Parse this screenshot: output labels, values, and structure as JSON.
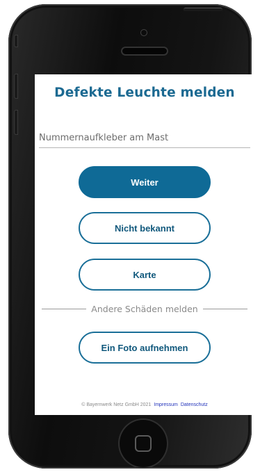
{
  "screen": {
    "title": "Defekte Leuchte melden",
    "number_input": {
      "placeholder": "Nummernaufkleber am Mast",
      "value": ""
    },
    "buttons": {
      "weiter": "Weiter",
      "nicht_bekannt": "Nicht bekannt",
      "karte": "Karte",
      "foto": "Ein Foto aufnehmen"
    },
    "divider_label": "Andere Schäden melden",
    "footer": {
      "copyright": "© Bayernwerk Netz GmbH 2021",
      "impressum": "Impressum",
      "datenschutz": "Datenschutz"
    }
  },
  "colors": {
    "accent": "#0f6a96",
    "title": "#1c6a92",
    "link": "#2233bb",
    "phone_frame": "#111111"
  },
  "icons": {
    "home_button": "home-square-icon",
    "camera": "front-camera-icon",
    "speaker": "earpiece-speaker-icon"
  }
}
